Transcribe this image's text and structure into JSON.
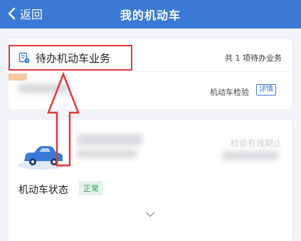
{
  "navbar": {
    "back_label": "返回",
    "title": "我的机动车"
  },
  "todo": {
    "title": "待办机动车业务",
    "count_text": "共 1 项待办业务",
    "item": {
      "type": "机动车检验",
      "detail_label": "详情"
    }
  },
  "vehicle": {
    "faded_text": "检验有效期止",
    "status_label": "机动车状态",
    "status_value": "正常"
  },
  "colors": {
    "nav_blue": "#3a7ad6",
    "highlight_red": "#e03a3a",
    "status_green": "#3a9a58"
  }
}
